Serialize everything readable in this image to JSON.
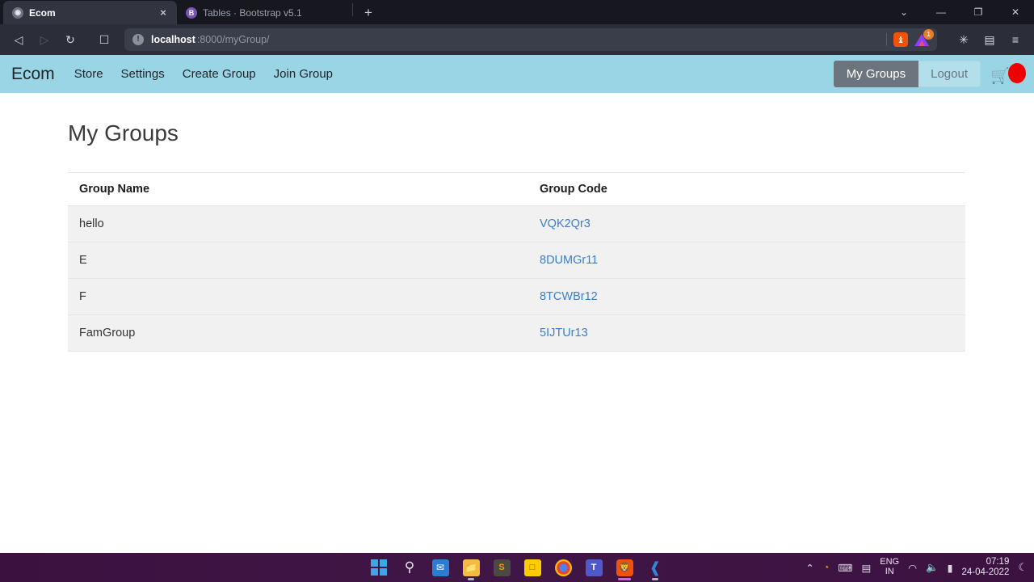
{
  "browser": {
    "tabs": [
      {
        "title": "Ecom",
        "icon": "globe-icon",
        "active": true,
        "close_label": "×"
      },
      {
        "title": "Tables · Bootstrap v5.1",
        "icon": "bootstrap-icon",
        "active": false
      }
    ],
    "new_tab_label": "+",
    "window_controls": {
      "tab_search": "⌄",
      "minimize": "—",
      "restore": "❐",
      "close": "✕"
    },
    "toolbar": {
      "back": "◁",
      "forward": "▷",
      "reload": "↻",
      "bookmark": "☐",
      "extensions": "✳",
      "wallet": "▤",
      "menu": "≡"
    },
    "url": {
      "info_icon": "!",
      "host": "localhost",
      "rest": ":8000/myGroup/"
    },
    "shield": {
      "name": "brave-shield-icon",
      "glyph": "♝"
    },
    "rewards": {
      "name": "brave-rewards-triangle-icon",
      "badge": "1"
    }
  },
  "navbar": {
    "brand": "Ecom",
    "links": [
      {
        "label": "Store"
      },
      {
        "label": "Settings"
      },
      {
        "label": "Create Group"
      },
      {
        "label": "Join Group"
      }
    ],
    "my_groups_button": "My Groups",
    "logout_button": "Logout",
    "cart_icon": "🛒",
    "accent_color": "#9ad5e5",
    "active_button_color": "#6c757d",
    "cart_badge_color": "#ee0000"
  },
  "main": {
    "title": "My Groups",
    "table": {
      "columns": [
        "Group Name",
        "Group Code"
      ],
      "rows": [
        {
          "name": "hello",
          "code": "VQK2Qr3"
        },
        {
          "name": "E",
          "code": "8DUMGr11"
        },
        {
          "name": "F",
          "code": "8TCWBr12"
        },
        {
          "name": "FamGroup",
          "code": "5IJTUr13"
        }
      ],
      "link_color": "#3d7eca"
    }
  },
  "taskbar": {
    "apps": [
      {
        "name": "start-button"
      },
      {
        "name": "search-icon"
      },
      {
        "name": "mail-icon"
      },
      {
        "name": "file-explorer-icon"
      },
      {
        "name": "sublime-text-icon"
      },
      {
        "name": "sticky-notes-icon"
      },
      {
        "name": "chrome-icon"
      },
      {
        "name": "teams-icon"
      },
      {
        "name": "brave-icon"
      },
      {
        "name": "vscode-icon"
      }
    ],
    "tray": {
      "chevron": "⌃",
      "sync": "◔",
      "keyboard": "⌨",
      "touchpad": "▤",
      "language_line1": "ENG",
      "language_line2": "IN",
      "wifi": "◠",
      "volume": "🔈",
      "battery": "▮",
      "time": "07:19",
      "date": "24-04-2022",
      "do_not_disturb": "☾"
    }
  }
}
